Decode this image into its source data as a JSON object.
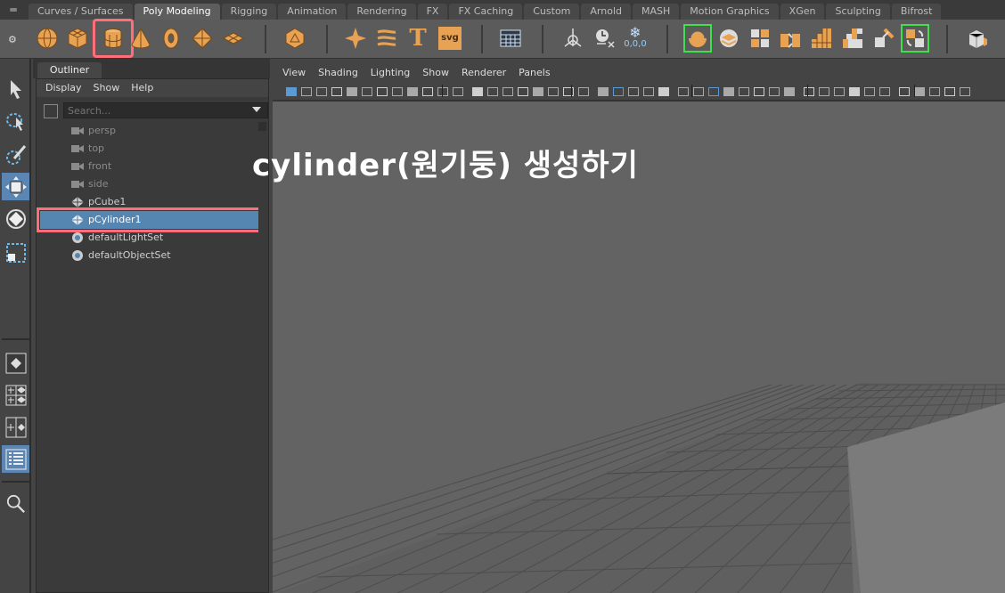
{
  "shelf": {
    "handle_icon": "shelf-handle-icon",
    "tabs": [
      {
        "label": "Curves / Surfaces"
      },
      {
        "label": "Poly Modeling"
      },
      {
        "label": "Rigging"
      },
      {
        "label": "Animation"
      },
      {
        "label": "Rendering"
      },
      {
        "label": "FX"
      },
      {
        "label": "FX Caching"
      },
      {
        "label": "Custom"
      },
      {
        "label": "Arnold"
      },
      {
        "label": "MASH"
      },
      {
        "label": "Motion Graphics"
      },
      {
        "label": "XGen"
      },
      {
        "label": "Sculpting"
      },
      {
        "label": "Bifrost"
      }
    ],
    "active_tab": "Poly Modeling",
    "icons": [
      "sphere-icon",
      "cube-icon",
      "cylinder-icon",
      "cone-icon",
      "torus-icon",
      "pyramid-icon",
      "plane-icon",
      "platonic-icon",
      "star-icon",
      "helix-icon",
      "text-icon",
      "svg-icon",
      "table-icon",
      "transform-icon",
      "clock-icon",
      "snowflake-icon",
      "combine-icon",
      "separate-icon",
      "boolean-icon",
      "extrude-icon",
      "bevel-icon",
      "bridge-icon",
      "merge-icon",
      "uv-icon",
      "loop-icon"
    ],
    "text_label": "T",
    "svg_label": "svg",
    "coords_label": "0,0,0"
  },
  "toolbox": {
    "tools": [
      "select-tool-icon",
      "lasso-tool-icon",
      "paint-select-tool-icon",
      "move-tool-icon",
      "rotate-tool-icon",
      "scale-tool-icon",
      "layout-single-icon",
      "layout-quad-icon",
      "layout-two-icon",
      "outliner-layout-icon",
      "search-icon"
    ]
  },
  "outliner": {
    "tab_label": "Outliner",
    "menu": [
      "Display",
      "Show",
      "Help"
    ],
    "search_placeholder": "Search...",
    "items": [
      {
        "label": "persp",
        "icon": "camera-icon",
        "dim": true
      },
      {
        "label": "top",
        "icon": "camera-icon",
        "dim": true
      },
      {
        "label": "front",
        "icon": "camera-icon",
        "dim": true
      },
      {
        "label": "side",
        "icon": "camera-icon",
        "dim": true
      },
      {
        "label": "pCube1",
        "icon": "mesh-icon",
        "dim": false
      },
      {
        "label": "pCylinder1",
        "icon": "mesh-icon",
        "dim": false,
        "selected": true
      },
      {
        "label": "defaultLightSet",
        "icon": "set-icon",
        "dim": false
      },
      {
        "label": "defaultObjectSet",
        "icon": "set-icon",
        "dim": false
      }
    ]
  },
  "viewport": {
    "menu": [
      "View",
      "Shading",
      "Lighting",
      "Show",
      "Renderer",
      "Panels"
    ],
    "toolbar_icons": [
      "camera-select-icon",
      "camera-attrs-icon",
      "bookmark-icon",
      "image-plane-icon",
      "grid-icon",
      "resolution-gate-icon",
      "wireframe-icon",
      "smooth-shade-icon",
      "textured-icon",
      "lighting-icon",
      "shadows-icon",
      "isolate-icon",
      "xray-icon"
    ],
    "overlay_title": "cylinder(원기둥) 생성하기"
  },
  "colors": {
    "highlight": "#ff6e79",
    "selection": "#5586b2",
    "shelf_orange": "#e8a253",
    "viewport_bg": "#636363"
  }
}
